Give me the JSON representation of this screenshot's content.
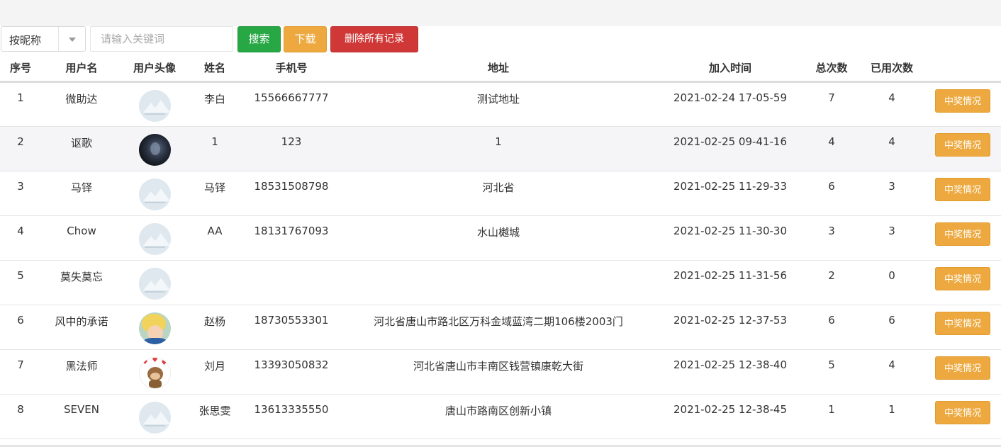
{
  "toolbar": {
    "filter_select": "按昵称",
    "search_placeholder": "请输入关键词",
    "search_label": "搜索",
    "download_label": "下载",
    "delete_all_label": "删除所有记录"
  },
  "table": {
    "headers": {
      "seq": "序号",
      "username": "用户名",
      "avatar": "用户头像",
      "name": "姓名",
      "phone": "手机号",
      "address": "地址",
      "join_time": "加入时间",
      "total": "总次数",
      "used": "已用次数"
    },
    "action_label": "中奖情况",
    "rows": [
      {
        "seq": "1",
        "username": "微助达",
        "avatar": "placeholder-avatar",
        "name": "李白",
        "phone": "15566667777",
        "address": "测试地址",
        "join_time": "2021-02-24 17-05-59",
        "total": "7",
        "used": "4"
      },
      {
        "seq": "2",
        "username": "讴歌",
        "avatar": "dark-photo-avatar",
        "name": "1",
        "phone": "123",
        "address": "1",
        "join_time": "2021-02-25 09-41-16",
        "total": "4",
        "used": "4"
      },
      {
        "seq": "3",
        "username": "马铎",
        "avatar": "placeholder-avatar",
        "name": "马铎",
        "phone": "18531508798",
        "address": "河北省",
        "join_time": "2021-02-25 11-29-33",
        "total": "6",
        "used": "3"
      },
      {
        "seq": "4",
        "username": "Chow",
        "avatar": "placeholder-avatar",
        "name": "AA",
        "phone": "18131767093",
        "address": "水山樾城",
        "join_time": "2021-02-25 11-30-30",
        "total": "3",
        "used": "3"
      },
      {
        "seq": "5",
        "username": "莫失莫忘",
        "avatar": "placeholder-avatar",
        "name": "",
        "phone": "",
        "address": "",
        "join_time": "2021-02-25 11-31-56",
        "total": "2",
        "used": "0"
      },
      {
        "seq": "6",
        "username": "风中的承诺",
        "avatar": "anime-avatar",
        "name": "赵杨",
        "phone": "18730553301",
        "address": "河北省唐山市路北区万科金域蓝湾二期106楼2003门",
        "join_time": "2021-02-25 12-37-53",
        "total": "6",
        "used": "6"
      },
      {
        "seq": "7",
        "username": "黑法师",
        "avatar": "monkey-avatar",
        "name": "刘月",
        "phone": "13393050832",
        "address": "河北省唐山市丰南区钱营镇康乾大街",
        "join_time": "2021-02-25 12-38-40",
        "total": "5",
        "used": "4"
      },
      {
        "seq": "8",
        "username": "SEVEN",
        "avatar": "placeholder-avatar",
        "name": "张思雯",
        "phone": "13613335550",
        "address": "唐山市路南区创新小镇",
        "join_time": "2021-02-25 12-38-45",
        "total": "1",
        "used": "1"
      }
    ]
  },
  "colors": {
    "search": "#28a745",
    "download": "#eda93f",
    "delete": "#d03737",
    "action": "#eda93f"
  }
}
